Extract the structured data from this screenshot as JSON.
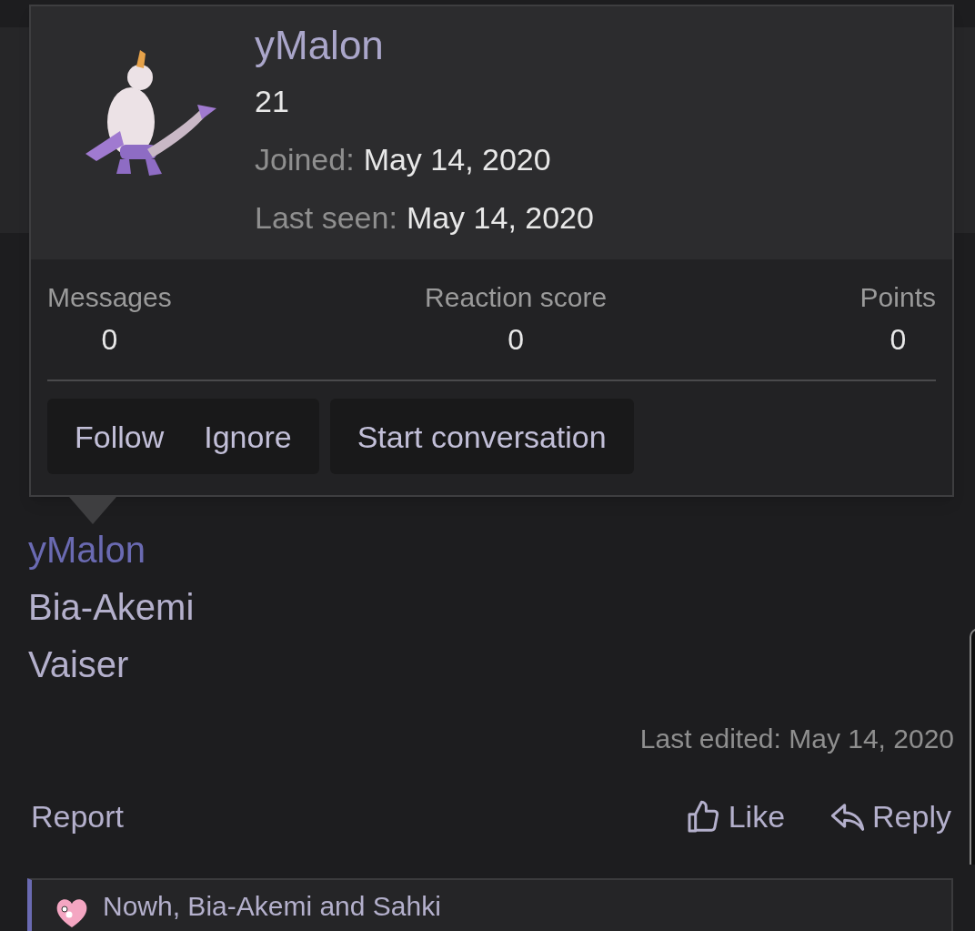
{
  "popup": {
    "avatar": {
      "kind": "picture"
    },
    "username": "yMalon",
    "user_title": "21",
    "details": [
      {
        "label": "Joined:",
        "value": "May 14, 2020"
      },
      {
        "label": "Last seen:",
        "value": "May 14, 2020"
      }
    ],
    "stats": [
      {
        "label": "Messages",
        "value": "0"
      },
      {
        "label": "Reaction score",
        "value": "0"
      },
      {
        "label": "Points",
        "value": "0"
      }
    ],
    "button_groups": [
      [
        "Follow",
        "Ignore"
      ],
      [
        "Start conversation"
      ]
    ]
  },
  "post": {
    "lines": [
      {
        "text": "yMalon",
        "kind": "link"
      },
      {
        "text": "Bia-Akemi",
        "kind": "text"
      },
      {
        "text": "Vaiser",
        "kind": "text"
      }
    ],
    "last_edited": "Last edited: May 14, 2020",
    "report": "Report",
    "like": "Like",
    "reply": "Reply",
    "reactions": "Nowh, Bia-Akemi and Sahki"
  }
}
